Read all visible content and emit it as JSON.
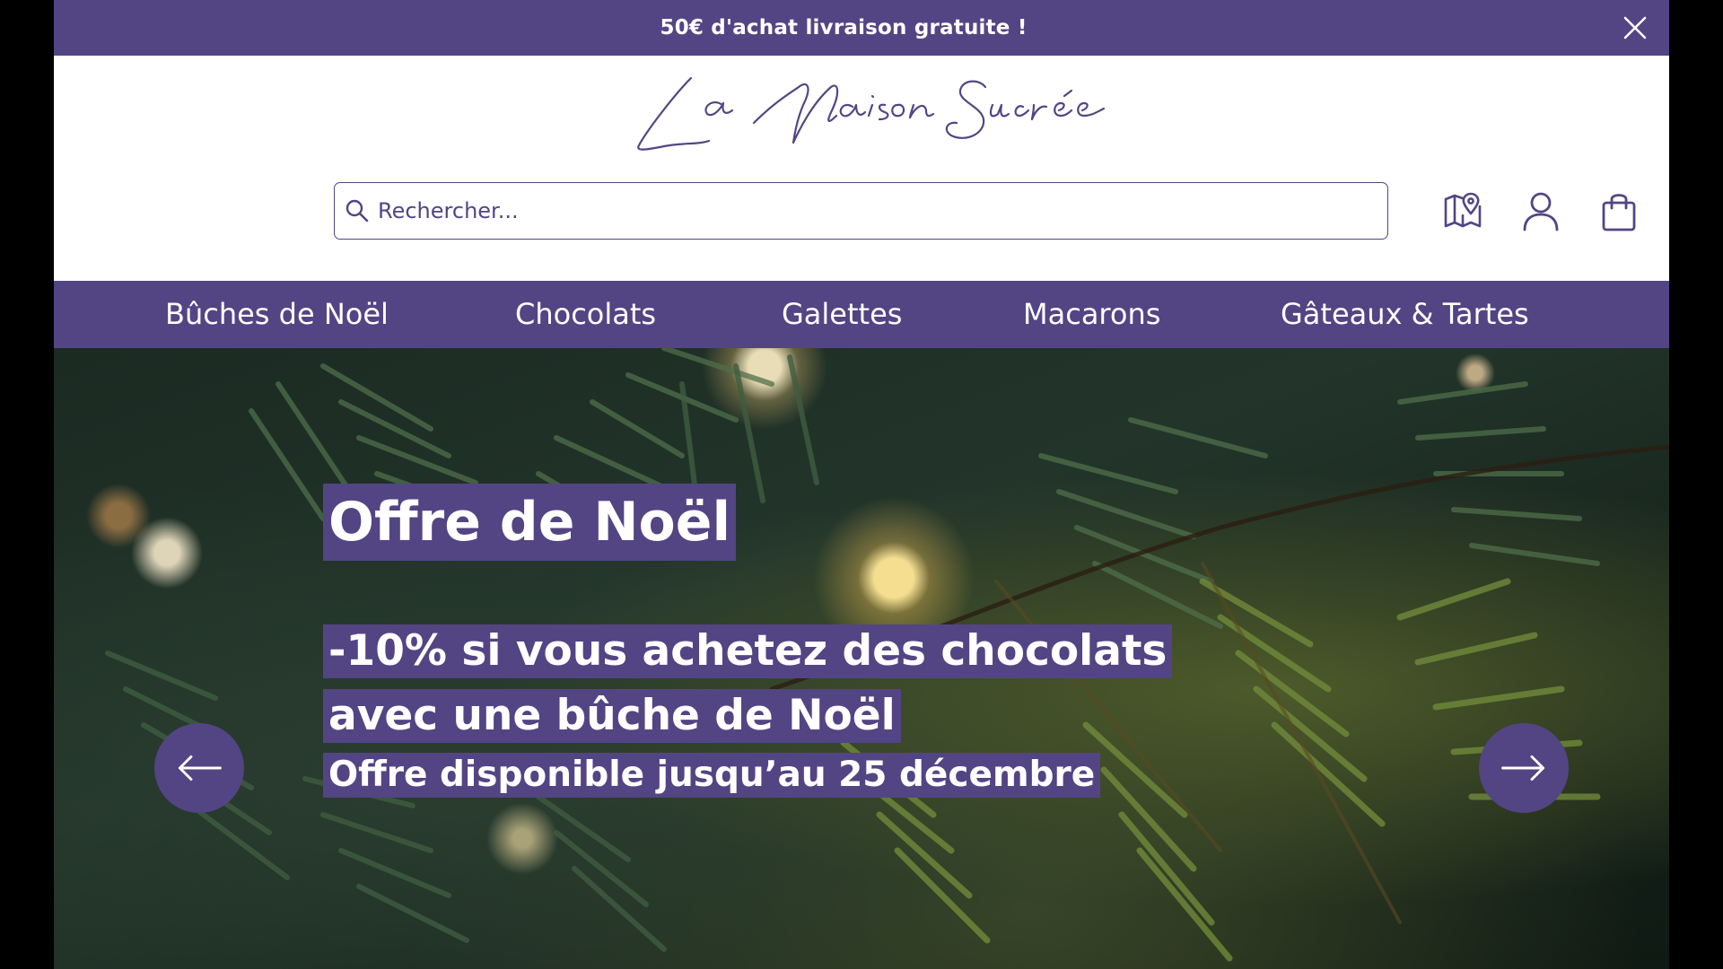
{
  "promo": {
    "text": "50€ d'achat livraison gratuite !"
  },
  "brand": {
    "name": "La Maison Sucrée"
  },
  "search": {
    "placeholder": "Rechercher..."
  },
  "header_icons": [
    "map-pin-icon",
    "user-icon",
    "shopping-bag-icon"
  ],
  "nav": {
    "items": [
      "Bûches de Noël",
      "Chocolats",
      "Galettes",
      "Macarons",
      "Gâteaux & Tartes"
    ]
  },
  "hero": {
    "title": "Offre de Noël",
    "line1": "-10% si vous achetez des chocolats",
    "line2": "avec une bûche de Noël",
    "subtitle": "Offre disponible jusqu’au 25 décembre"
  },
  "colors": {
    "accent": "#534584",
    "text_on_accent": "#ffffff",
    "background": "#ffffff"
  }
}
